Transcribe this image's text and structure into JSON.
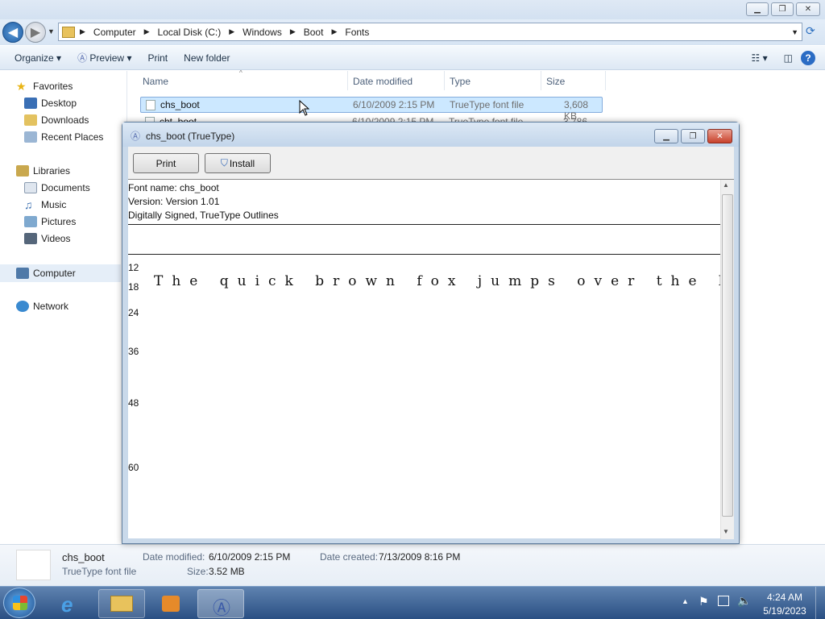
{
  "address": {
    "crumbs": [
      "Computer",
      "Local Disk (C:)",
      "Windows",
      "Boot",
      "Fonts"
    ]
  },
  "toolbar": {
    "organize": "Organize",
    "preview": "Preview",
    "print": "Print",
    "new_folder": "New folder"
  },
  "nav": {
    "favorites": "Favorites",
    "desktop": "Desktop",
    "downloads": "Downloads",
    "recent": "Recent Places",
    "libraries": "Libraries",
    "documents": "Documents",
    "music": "Music",
    "pictures": "Pictures",
    "videos": "Videos",
    "computer": "Computer",
    "network": "Network"
  },
  "columns": {
    "name": "Name",
    "date": "Date modified",
    "type": "Type",
    "size": "Size"
  },
  "files": [
    {
      "name": "chs_boot",
      "date": "6/10/2009 2:15 PM",
      "type": "TrueType font file",
      "size": "3,608 KB"
    },
    {
      "name": "cht_boot",
      "date": "6/10/2009 2:15 PM",
      "type": "TrueType font file",
      "size": "3,786 KB"
    }
  ],
  "details": {
    "name": "chs_boot",
    "type": "TrueType font file",
    "date_modified_label": "Date modified:",
    "date_modified": "6/10/2009 2:15 PM",
    "date_created_label": "Date created:",
    "date_created": "7/13/2009 8:16 PM",
    "size_label": "Size:",
    "size": "3.52 MB"
  },
  "dialog": {
    "title": "chs_boot (TrueType)",
    "print": "Print",
    "install": "Install",
    "font_name": "Font name: chs_boot",
    "version": "Version: Version 1.01",
    "signed": "Digitally Signed, TrueType Outlines",
    "sample": "The quick brown fox jumps over the l",
    "sizes": [
      "12",
      "18",
      "24",
      "36",
      "48",
      "60"
    ]
  },
  "clock": {
    "time": "4:24 AM",
    "date": "5/19/2023"
  },
  "colors": {
    "selection": "#cce8ff",
    "taskbar": "#2a4f83"
  }
}
